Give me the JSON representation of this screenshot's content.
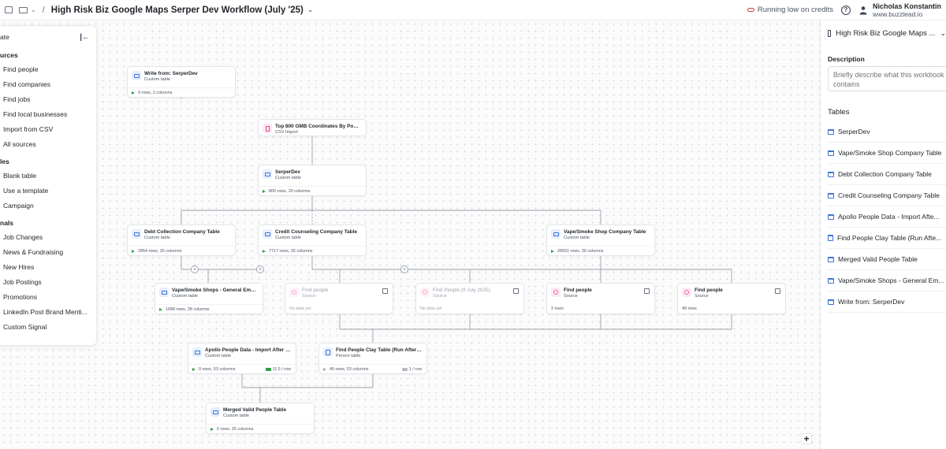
{
  "header": {
    "title": "High Risk Biz Google Maps Serper Dev Workflow (July '25)",
    "credits_status": "Running low on credits",
    "user_name": "Nicholas Konstantin",
    "user_company": "www.buzzlead.io"
  },
  "left_panel": {
    "title": "ate",
    "sections": [
      {
        "label": "urces",
        "items": [
          "Find people",
          "Find companies",
          "Find jobs",
          "Find local businesses",
          "Import from CSV",
          "All sources"
        ]
      },
      {
        "label": "les",
        "items": [
          "Blank table",
          "Use a template",
          "Campaign"
        ]
      },
      {
        "label": "nals",
        "items": [
          "Job Changes",
          "News & Fundraising",
          "New Hires",
          "Job Postings",
          "Promotions",
          "LinkedIn Post Brand Menti...",
          "Custom Signal"
        ]
      }
    ]
  },
  "nodes": {
    "write_from": {
      "title": "Write from: SerperDev",
      "subtitle": "Custom table",
      "meta": "0 rows, 2 columns"
    },
    "top800": {
      "title": "Top 800 GMB Coordinates By Populati...",
      "subtitle": "CSV Import"
    },
    "serperdev": {
      "title": "SerperDev",
      "subtitle": "Custom table",
      "meta": "800 rows, 20 columns"
    },
    "debt": {
      "title": "Debt Collection Company Table",
      "subtitle": "Custom table",
      "meta": "2854 rows, 26 columns"
    },
    "credit": {
      "title": "Credit Counseling Company Table",
      "subtitle": "Custom table",
      "meta": "7717 rows, 26 columns"
    },
    "vape": {
      "title": "Vape/Smoke Shop Company Table",
      "subtitle": "Custom table",
      "meta": "28501 rows, 30 columns"
    },
    "vape_emails": {
      "title": "Vape/Smoke Shops - General Emails T...",
      "subtitle": "Custom table",
      "meta": "1688 rows, 28 columns"
    },
    "find1": {
      "title": "Find people",
      "subtitle": "Source",
      "meta": "No data yet"
    },
    "find_july": {
      "title": "Find People (9 July 2025)",
      "subtitle": "Source",
      "meta": "No data yet"
    },
    "find2": {
      "title": "Find people",
      "subtitle": "Source",
      "meta": "2 rows"
    },
    "find3": {
      "title": "Find people",
      "subtitle": "Source",
      "meta": "49 rows"
    },
    "apollo": {
      "title": "Apollo People Data - Import After Com...",
      "subtitle": "Custom table",
      "meta": "0 rows, 53 columns",
      "credit": "11.5 / row"
    },
    "clay": {
      "title": "Find People Clay Table (Run After Apol...",
      "subtitle": "Person table",
      "meta": "49 rows, 53 columns",
      "credit": "1 / row"
    },
    "merged": {
      "title": "Merged Valid People Table",
      "subtitle": "Custom table",
      "meta": "0 rows, 26 columns"
    }
  },
  "right_panel": {
    "title": "High Risk Biz Google Maps ...",
    "description_label": "Description",
    "description_placeholder": "Briefly describe what this workbook contains",
    "tables_label": "Tables",
    "tables": [
      "SerperDev",
      "Vape/Smoke Shop Company Table",
      "Debt Collection Company Table",
      "Credit Counseling Company Table",
      "Apollo People Data - Import Afte...",
      "Find People Clay Table (Run Afte...",
      "Merged Valid People Table",
      "Vape/Smoke Shops - General Em...",
      "Write from: SerperDev"
    ]
  },
  "colors": {
    "accent_blue": "#3b73d9",
    "success_green": "#2f9e44",
    "source_pink": "#e86aa8",
    "warning_red": "#d9363e"
  }
}
